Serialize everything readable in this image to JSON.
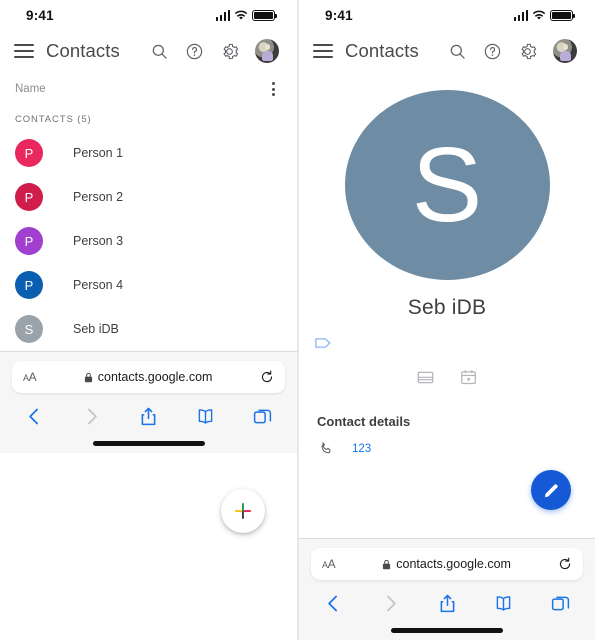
{
  "theme": {
    "accent_blue": "#1a73e8",
    "fab_blue": "#1559d6",
    "text_primary": "#3c4043",
    "text_secondary": "#8a8d90",
    "divider": "#e6e8ea"
  },
  "status_bar": {
    "time": "9:41",
    "signal_icon": "cellular-bars-icon",
    "wifi_icon": "wifi-icon",
    "battery_icon": "battery-full-icon"
  },
  "app_header": {
    "menu_icon": "hamburger-menu-icon",
    "title": "Contacts",
    "search_icon": "search-icon",
    "help_icon": "help-circle-icon",
    "settings_icon": "gear-icon",
    "account_avatar": "account-avatar"
  },
  "left_panel": {
    "list_header": {
      "label": "Name",
      "overflow_icon": "kebab-menu-icon"
    },
    "section_label": "CONTACTS (5)",
    "contacts": [
      {
        "name": "Person 1",
        "initial": "P",
        "color": "#e8285f"
      },
      {
        "name": "Person 2",
        "initial": "P",
        "color": "#d01d4b"
      },
      {
        "name": "Person 3",
        "initial": "P",
        "color": "#a13fcf"
      },
      {
        "name": "Person 4",
        "initial": "P",
        "color": "#0b5fb0"
      },
      {
        "name": "Seb iDB",
        "initial": "S",
        "color": "#9aa3a9"
      }
    ],
    "fab": {
      "icon": "plus-icon",
      "label": "Create contact"
    }
  },
  "right_panel": {
    "avatar": {
      "initial": "S",
      "color": "#6e8ca3"
    },
    "name": "Seb iDB",
    "label_icon": "label-tag-icon",
    "quick_actions": [
      {
        "icon": "email-icon"
      },
      {
        "icon": "calendar-icon"
      }
    ],
    "details_title": "Contact details",
    "details": [
      {
        "icon": "phone-icon",
        "value": "123"
      }
    ],
    "fab": {
      "icon": "pencil-edit-icon",
      "label": "Edit contact"
    }
  },
  "browser_bar": {
    "text_size_label": "AA",
    "lock_icon": "lock-icon",
    "url": "contacts.google.com",
    "reload_icon": "reload-icon",
    "back_icon": "chevron-left-icon",
    "forward_icon": "chevron-right-icon",
    "share_icon": "share-icon",
    "bookmarks_icon": "book-icon",
    "tabs_icon": "tabs-icon"
  }
}
